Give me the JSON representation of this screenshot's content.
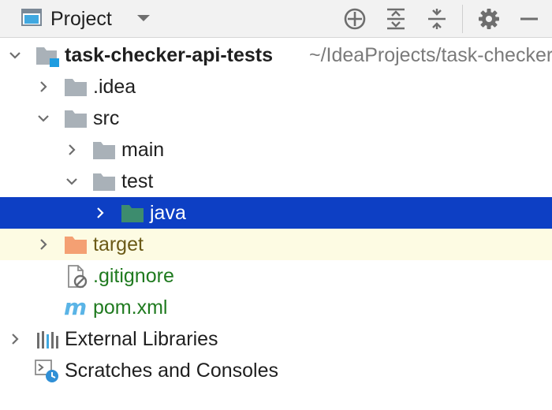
{
  "header": {
    "title": "Project",
    "icons": {
      "view": "project-view-icon",
      "dropdown": "chevron-down-icon",
      "locate": "crosshair-icon",
      "expand": "expand-all-icon",
      "collapse": "collapse-all-icon",
      "settings": "gear-icon",
      "hide": "minimize-icon"
    }
  },
  "tree": {
    "root": {
      "name": "task-checker-api-tests",
      "path": "~/IdeaProjects/task-checker-api-tests",
      "expanded": true
    },
    "items": [
      {
        "label": ".idea",
        "type": "folder",
        "expanded": false
      },
      {
        "label": "src",
        "type": "folder",
        "expanded": true
      },
      {
        "label": "main",
        "type": "folder",
        "expanded": false
      },
      {
        "label": "test",
        "type": "folder",
        "expanded": true
      },
      {
        "label": "java",
        "type": "test-sources-folder",
        "expanded": false,
        "selected": true
      },
      {
        "label": "target",
        "type": "excluded-folder",
        "expanded": false
      },
      {
        "label": ".gitignore",
        "type": "ignored-file"
      },
      {
        "label": "pom.xml",
        "type": "maven-file"
      },
      {
        "label": "External Libraries",
        "type": "libraries",
        "expanded": false
      },
      {
        "label": "Scratches and Consoles",
        "type": "scratches"
      }
    ]
  },
  "colors": {
    "selection": "#0d3fc4",
    "excluded_row": "#fdfbe3",
    "folder": "#a9b1b8",
    "test_folder": "#3d8c6e",
    "excluded_folder": "#f4a073",
    "vcs_added_text": "#1f7a1f",
    "path_text": "#7a7a7a"
  }
}
